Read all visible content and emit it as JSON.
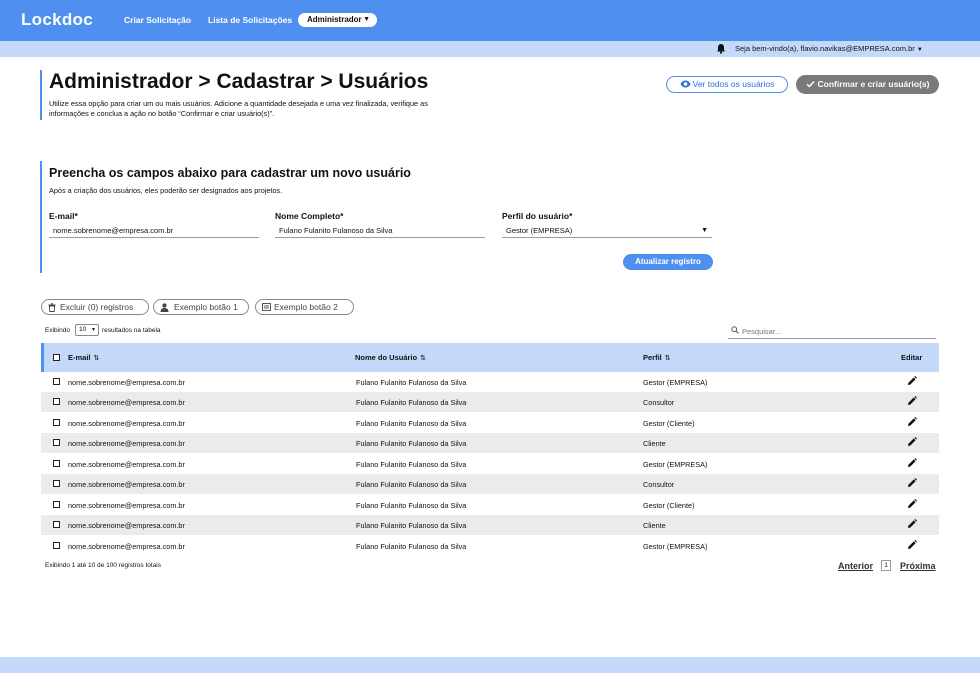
{
  "app": {
    "logo": "Lockdoc"
  },
  "nav": {
    "items": [
      "Criar Solicitação",
      "Lista de Solicitações"
    ],
    "admin_label": "Administrador"
  },
  "subbar": {
    "welcome": "Seja bem-vindo(a), flavio.navikas@EMPRESA.com.br"
  },
  "header": {
    "title": "Administrador > Cadastrar > Usuários",
    "description": "Utilize essa opção para criar um ou mais usuários. Adicione a quantidade desejada e uma vez finalizada, verifique as informações e conclua a ação no botão “Confirmar e criar usuário(s)”.",
    "view_all_label": "Ver todos os usuários",
    "confirm_label": "Confirmar e criar usuário(s)"
  },
  "form": {
    "title": "Preencha os campos abaixo para cadastrar um novo usuário",
    "description": "Após a criação dos usuários, eles poderão ser designados aos projetos.",
    "email_label": "E-mail*",
    "email_value": "nome.sobrenome@empresa.com.br",
    "name_label": "Nome Completo*",
    "name_value": "Fulano Fulanito Fulanoso da Silva",
    "profile_label": "Perfil do usuário*",
    "profile_value": "Gestor (EMPRESA)",
    "update_label": "Atualizar registro"
  },
  "actions": {
    "delete_label": "Excluir (0) registros",
    "example1_label": "Exemplo botão 1",
    "example2_label": "Exemplo botão 2"
  },
  "table_controls": {
    "show_prefix": "Exibindo",
    "page_size": "10",
    "show_suffix": "resultados na tabela",
    "search_placeholder": "Pesquisar..."
  },
  "table": {
    "columns": {
      "email": "E-mail",
      "name": "Nome do Usuário",
      "profile": "Perfil",
      "edit": "Editar"
    },
    "rows": [
      {
        "email": "nome.sobrenome@empresa.com.br",
        "name": "Fulano Fulanito Fulanoso da Silva",
        "profile": "Gestor (EMPRESA)"
      },
      {
        "email": "nome.sobrenome@empresa.com.br",
        "name": "Fulano Fulanito Fulanoso da Silva",
        "profile": "Consultor"
      },
      {
        "email": "nome.sobrenome@empresa.com.br",
        "name": "Fulano Fulanito Fulanoso da Silva",
        "profile": "Gestor (Cliente)"
      },
      {
        "email": "nome.sobrenome@empresa.com.br",
        "name": "Fulano Fulanito Fulanoso da Silva",
        "profile": "Cliente"
      },
      {
        "email": "nome.sobrenome@empresa.com.br",
        "name": "Fulano Fulanito Fulanoso da Silva",
        "profile": "Gestor (EMPRESA)"
      },
      {
        "email": "nome.sobrenome@empresa.com.br",
        "name": "Fulano Fulanito Fulanoso da Silva",
        "profile": "Consultor"
      },
      {
        "email": "nome.sobrenome@empresa.com.br",
        "name": "Fulano Fulanito Fulanoso da Silva",
        "profile": "Gestor (Cliente)"
      },
      {
        "email": "nome.sobrenome@empresa.com.br",
        "name": "Fulano Fulanito Fulanoso da Silva",
        "profile": "Cliente"
      },
      {
        "email": "nome.sobrenome@empresa.com.br",
        "name": "Fulano Fulanito Fulanoso da Silva",
        "profile": "Gestor (EMPRESA)"
      }
    ]
  },
  "pagination": {
    "info": "Exibindo 1 até 10 de 100 registros totais",
    "prev_label": "Anterior",
    "current_page": "1",
    "next_label": "Próxima"
  },
  "colors": {
    "primary": "#4f8ff0",
    "light": "#c4d9fa",
    "gray_button": "#7a7a7a"
  },
  "icons": [
    "bell-icon",
    "eye-icon",
    "check-icon",
    "trash-icon",
    "user-icon",
    "card-icon",
    "search-icon",
    "sort-icon",
    "pencil-icon",
    "chevron-down-icon"
  ]
}
